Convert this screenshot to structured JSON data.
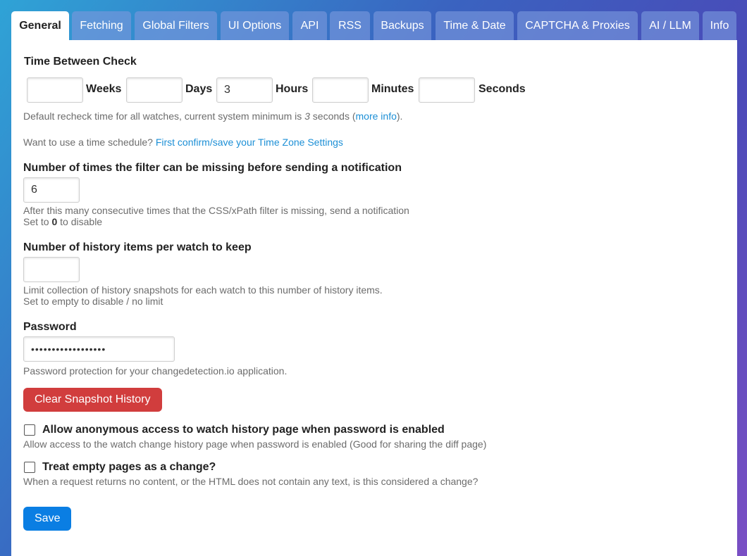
{
  "tabs": [
    {
      "label": "General",
      "active": true
    },
    {
      "label": "Fetching",
      "active": false
    },
    {
      "label": "Global Filters",
      "active": false
    },
    {
      "label": "UI Options",
      "active": false
    },
    {
      "label": "API",
      "active": false
    },
    {
      "label": "RSS",
      "active": false
    },
    {
      "label": "Backups",
      "active": false
    },
    {
      "label": "Time & Date",
      "active": false
    },
    {
      "label": "CAPTCHA & Proxies",
      "active": false
    },
    {
      "label": "AI / LLM",
      "active": false
    },
    {
      "label": "Info",
      "active": false
    }
  ],
  "time_between_check": {
    "label": "Time Between Check",
    "weeks": {
      "value": "",
      "unit": "Weeks"
    },
    "days": {
      "value": "",
      "unit": "Days"
    },
    "hours": {
      "value": "3",
      "unit": "Hours"
    },
    "minutes": {
      "value": "",
      "unit": "Minutes"
    },
    "seconds": {
      "value": "",
      "unit": "Seconds"
    },
    "help_prefix": "Default recheck time for all watches, current system minimum is ",
    "help_minimum": "3",
    "help_middle": " seconds (",
    "help_link": "more info",
    "help_suffix": ")."
  },
  "schedule": {
    "text": "Want to use a time schedule? ",
    "link": "First confirm/save your Time Zone Settings"
  },
  "filter_missing": {
    "label": "Number of times the filter can be missing before sending a notification",
    "value": "6",
    "help_line1": "After this many consecutive times that the CSS/xPath filter is missing, send a notification",
    "help_line2_prefix": "Set to ",
    "help_line2_bold": "0",
    "help_line2_suffix": " to disable"
  },
  "history_items": {
    "label": "Number of history items per watch to keep",
    "value": "",
    "help_line1": "Limit collection of history snapshots for each watch to this number of history items.",
    "help_line2": "Set to empty to disable / no limit"
  },
  "password": {
    "label": "Password",
    "value": "••••••••••••••••••",
    "help": "Password protection for your changedetection.io application."
  },
  "clear_history_button": "Clear Snapshot History",
  "anonymous_access": {
    "checked": false,
    "label": "Allow anonymous access to watch history page when password is enabled",
    "help": "Allow access to the watch change history page when password is enabled (Good for sharing the diff page)"
  },
  "empty_pages": {
    "checked": false,
    "label": "Treat empty pages as a change?",
    "help": "When a request returns no content, or the HTML does not contain any text, is this considered a change?"
  },
  "save_button": "Save",
  "colors": {
    "tab_inactive": "#7896dc",
    "danger": "#d13d3d",
    "primary": "#0a7ee3",
    "link": "#1c8fd6"
  }
}
